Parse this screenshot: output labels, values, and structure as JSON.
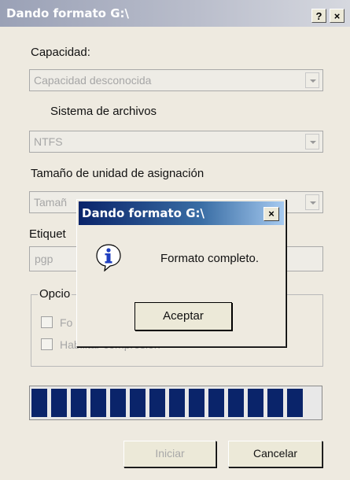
{
  "window": {
    "title": "Dando formato G:\\",
    "help_button": "?",
    "close_button": "×"
  },
  "form": {
    "capacity_label": "Capacidad:",
    "capacity_value": "Capacidad desconocida",
    "filesystem_label": "Sistema de archivos",
    "filesystem_value": "NTFS",
    "alloc_label": "Tamaño de unidad de asignación",
    "alloc_value": "Tamañ",
    "volume_label": "Etiquet",
    "volume_value": "pgp",
    "options_legend": "Opcio",
    "option1_label": "Fo",
    "option2_label": "Habilitar compresión"
  },
  "progress": {
    "segments": 14,
    "fraction": 1.0
  },
  "buttons": {
    "start": "Iniciar",
    "cancel": "Cancelar"
  },
  "dialog": {
    "title": "Dando formato G:\\",
    "close": "×",
    "icon": "info-icon",
    "message": "Formato completo.",
    "ok": "Aceptar"
  },
  "colors": {
    "progress_fill": "#0a246a",
    "dialog_title": "#0a246a"
  }
}
